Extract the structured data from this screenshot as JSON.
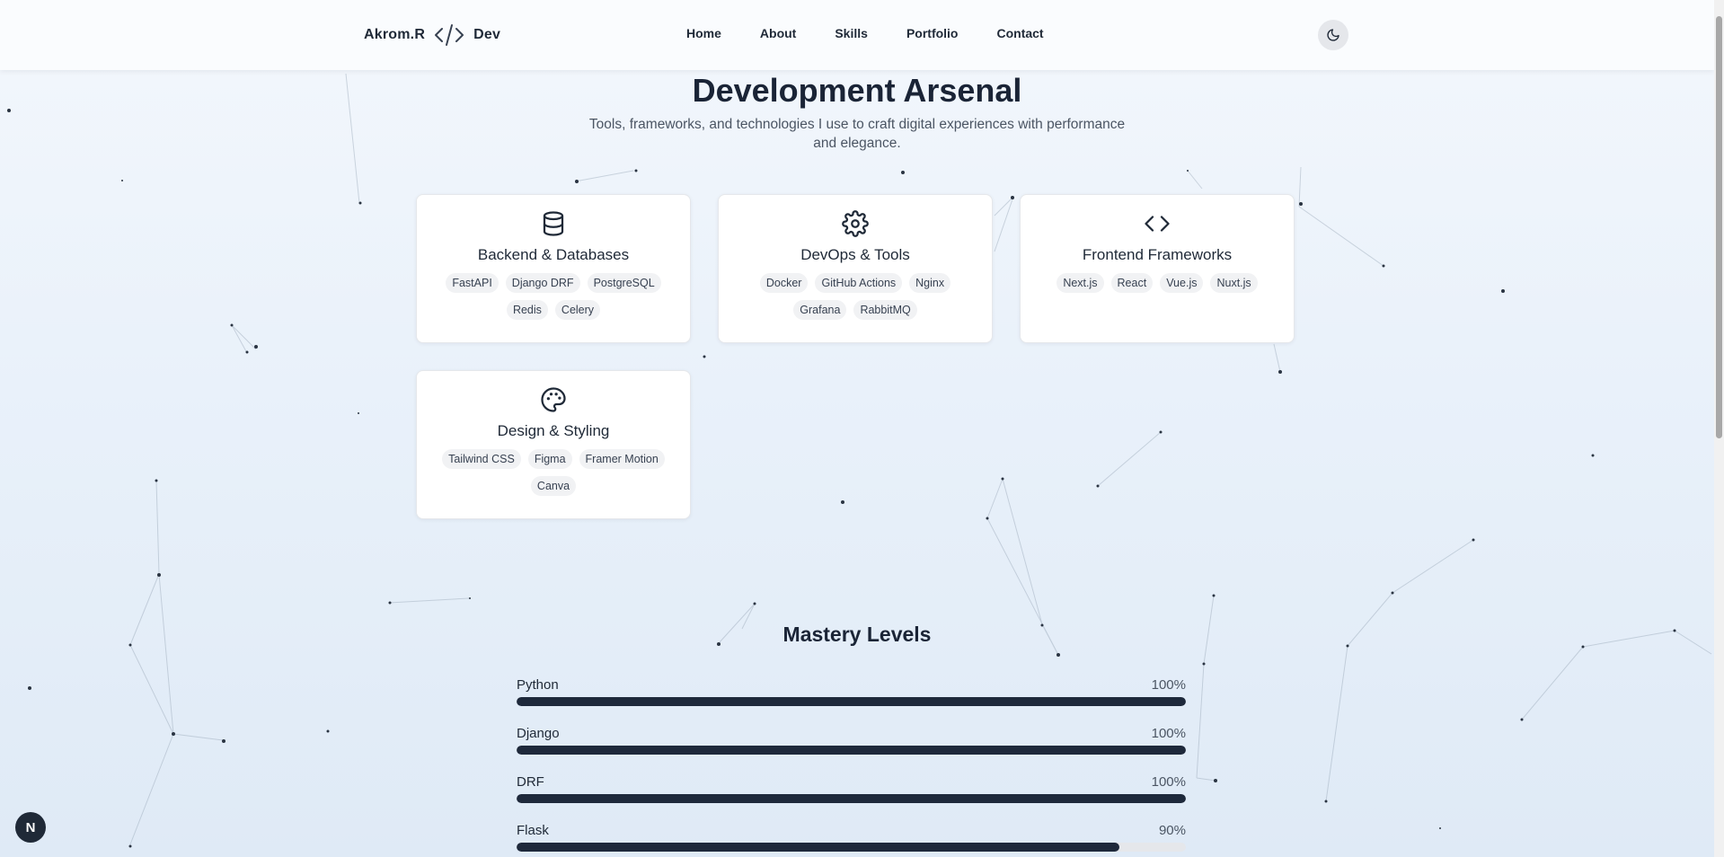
{
  "header": {
    "brand_name": "Akrom.R",
    "brand_suffix": "Dev",
    "nav": [
      "Home",
      "About",
      "Skills",
      "Portfolio",
      "Contact"
    ],
    "theme_icon": "moon-icon"
  },
  "arsenal": {
    "title": "Development Arsenal",
    "subtitle": "Tools, frameworks, and technologies I use to craft digital experiences with performance and elegance.",
    "cards": [
      {
        "icon": "database-icon",
        "title": "Backend & Databases",
        "tags": [
          "FastAPI",
          "Django DRF",
          "PostgreSQL",
          "Redis",
          "Celery"
        ]
      },
      {
        "icon": "gear-icon",
        "title": "DevOps & Tools",
        "tags": [
          "Docker",
          "GitHub Actions",
          "Nginx",
          "Grafana",
          "RabbitMQ"
        ]
      },
      {
        "icon": "code-icon",
        "title": "Frontend Frameworks",
        "tags": [
          "Next.js",
          "React",
          "Vue.js",
          "Nuxt.js"
        ]
      },
      {
        "icon": "palette-icon",
        "title": "Design & Styling",
        "tags": [
          "Tailwind CSS",
          "Figma",
          "Framer Motion",
          "Canva"
        ]
      }
    ]
  },
  "mastery": {
    "title": "Mastery Levels",
    "skills": [
      {
        "name": "Python",
        "percent_label": "100%",
        "level": 100
      },
      {
        "name": "Django",
        "percent_label": "100%",
        "level": 100
      },
      {
        "name": "DRF",
        "percent_label": "100%",
        "level": 100
      },
      {
        "name": "Flask",
        "percent_label": "90%",
        "level": 90
      }
    ]
  },
  "badge": {
    "label": "N"
  },
  "colors": {
    "accent": "#1e293b",
    "background": "#e9f1fa",
    "tag_bg": "#f1f2f4"
  }
}
